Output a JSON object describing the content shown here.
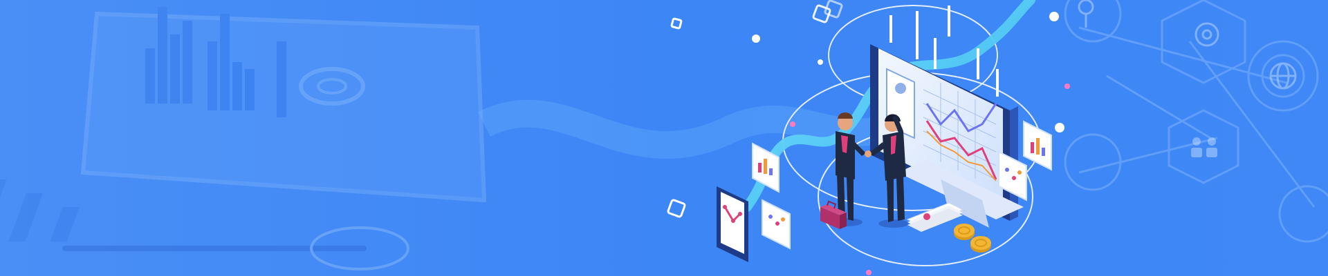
{
  "banner": {
    "colors": {
      "background": "#3d86f5",
      "background_light": "#5aa2fb",
      "accent_cyan": "#45c7f0",
      "suit_dark": "#1e2a44",
      "tie_red": "#e0407a",
      "coin_gold": "#f2b632",
      "briefcase": "#b0306a",
      "monitor_frame": "#1d3b87"
    },
    "illustration": "business-analytics-handshake",
    "icons": [
      "monitor-icon",
      "phone-icon",
      "briefcase-icon",
      "coin-icon",
      "document-icon",
      "gear-icon",
      "globe-icon",
      "people-icon",
      "search-icon"
    ]
  }
}
